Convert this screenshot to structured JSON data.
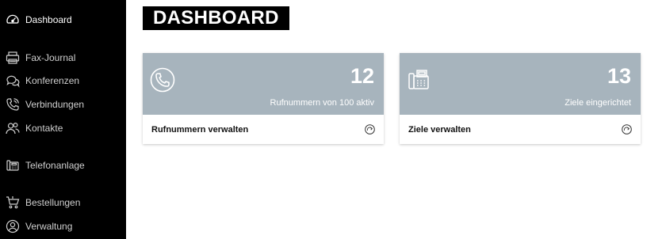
{
  "sidebar": {
    "items": [
      {
        "label": "Dashboard",
        "icon": "speedometer-icon",
        "active": true
      },
      {
        "label": "Fax-Journal",
        "icon": "fax-icon"
      },
      {
        "label": "Konferenzen",
        "icon": "chat-bubbles-icon"
      },
      {
        "label": "Verbindungen",
        "icon": "phone-icon"
      },
      {
        "label": "Kontakte",
        "icon": "contacts-icon"
      },
      {
        "label": "Telefonanlage",
        "icon": "phone-system-icon"
      },
      {
        "label": "Bestellungen",
        "icon": "cart-icon"
      },
      {
        "label": "Verwaltung",
        "icon": "user-circle-icon"
      }
    ]
  },
  "main": {
    "title": "DASHBOARD",
    "cards": [
      {
        "count": "12",
        "subtitle": "Rufnummern von 100 aktiv",
        "action": "Rufnummern verwalten",
        "icon": "phone-icon"
      },
      {
        "count": "13",
        "subtitle": "Ziele eingerichtet",
        "action": "Ziele verwalten",
        "icon": "desk-phone-icon"
      }
    ]
  },
  "colors": {
    "sidebar_bg": "#000000",
    "card_header_bg": "#a7b4bd",
    "title_bg": "#000000"
  }
}
